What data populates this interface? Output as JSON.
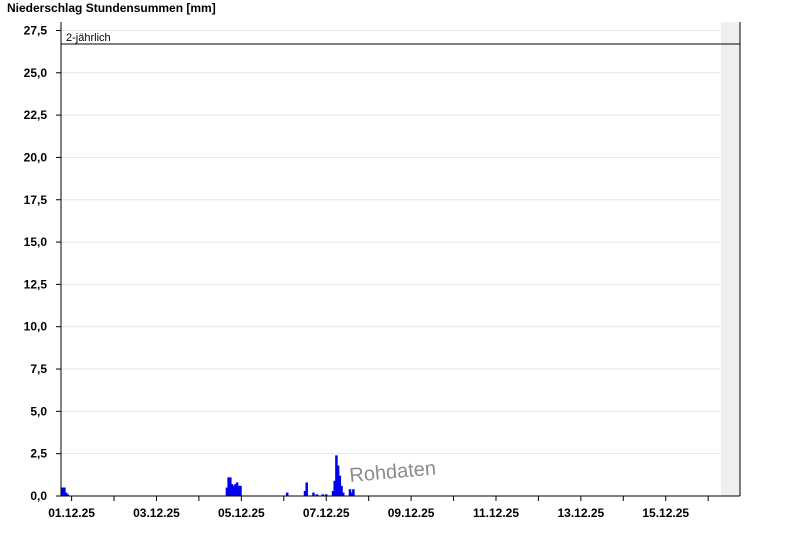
{
  "chart_data": {
    "type": "bar",
    "title": "Niederschlag Stundensummen [mm]",
    "xlabel": "",
    "ylabel": "",
    "ylim": [
      0,
      28
    ],
    "yticks": [
      0,
      2.5,
      5,
      7.5,
      10,
      12.5,
      15,
      17.5,
      20,
      22.5,
      25,
      27.5
    ],
    "ytick_labels": [
      "0,0",
      "2,5",
      "5,0",
      "7,5",
      "10,0",
      "12,5",
      "15,0",
      "17,5",
      "20,0",
      "22,5",
      "25,0",
      "27,5"
    ],
    "x_unit": "days since 30.11.25 00:00",
    "xlim": [
      0.75,
      16.75
    ],
    "forecast_region_start": 16.3,
    "xtick_positions": [
      1,
      3,
      5,
      7,
      9,
      11,
      13,
      15
    ],
    "xtick_labels": [
      "01.12.25",
      "03.12.25",
      "05.12.25",
      "07.12.25",
      "09.12.25",
      "11.12.25",
      "13.12.25",
      "15.12.25"
    ],
    "reference_line": {
      "value": 26.7,
      "label": "2-jährlich"
    },
    "series": [
      {
        "color": "#0000ee",
        "bar_width_days": 0.045,
        "x": [
          0.79,
          0.83,
          0.87,
          0.91,
          4.66,
          4.7,
          4.74,
          4.78,
          4.82,
          4.86,
          4.9,
          4.94,
          4.98,
          6.08,
          6.5,
          6.54,
          6.7,
          6.78,
          6.92,
          7.0,
          7.16,
          7.2,
          7.24,
          7.28,
          7.32,
          7.36,
          7.4,
          7.56,
          7.6,
          7.64
        ],
        "values": [
          0.5,
          0.5,
          0.2,
          0.1,
          0.5,
          1.1,
          1.1,
          0.7,
          0.6,
          0.7,
          0.8,
          0.6,
          0.6,
          0.2,
          0.3,
          0.8,
          0.2,
          0.1,
          0.1,
          0.1,
          0.3,
          0.9,
          2.4,
          1.8,
          1.2,
          0.6,
          0.2,
          0.4,
          0.2,
          0.4
        ]
      }
    ],
    "watermark": "Rohdaten",
    "grid": true
  }
}
